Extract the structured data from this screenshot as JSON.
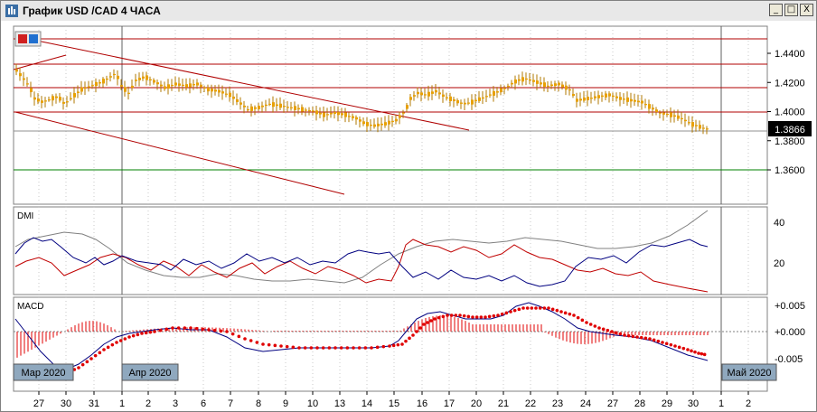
{
  "window": {
    "title": "График USD /CAD  4 ЧАСА",
    "minimize_label": "_",
    "maximize_label": "□",
    "close_label": "X"
  },
  "price_axis": {
    "ticks": [
      "1.4400",
      "1.4200",
      "1.4000",
      "1.3800",
      "1.3600"
    ],
    "current_price": "1.3866"
  },
  "dmi": {
    "label": "DMI",
    "ticks": [
      "40",
      "20"
    ]
  },
  "macd": {
    "label": "MACD",
    "ticks": [
      "+0.005",
      "+0.000",
      "-0.005"
    ]
  },
  "period_labels": [
    "Мар 2020",
    "Апр 2020",
    "Май 2020"
  ],
  "time_axis": [
    "27",
    "30",
    "31",
    "1",
    "2",
    "3",
    "6",
    "7",
    "8",
    "9",
    "10",
    "13",
    "14",
    "15",
    "16",
    "17",
    "20",
    "21",
    "22",
    "23",
    "24",
    "27",
    "28",
    "29",
    "30",
    "1",
    "2"
  ],
  "colors": {
    "candle": "#e8a000",
    "plus_di": "#000080",
    "minus_di": "#c00000",
    "adx": "#808080",
    "macd_line": "#000080",
    "signal": "#e00000",
    "trend": "#b00000",
    "support": "#008000"
  }
}
